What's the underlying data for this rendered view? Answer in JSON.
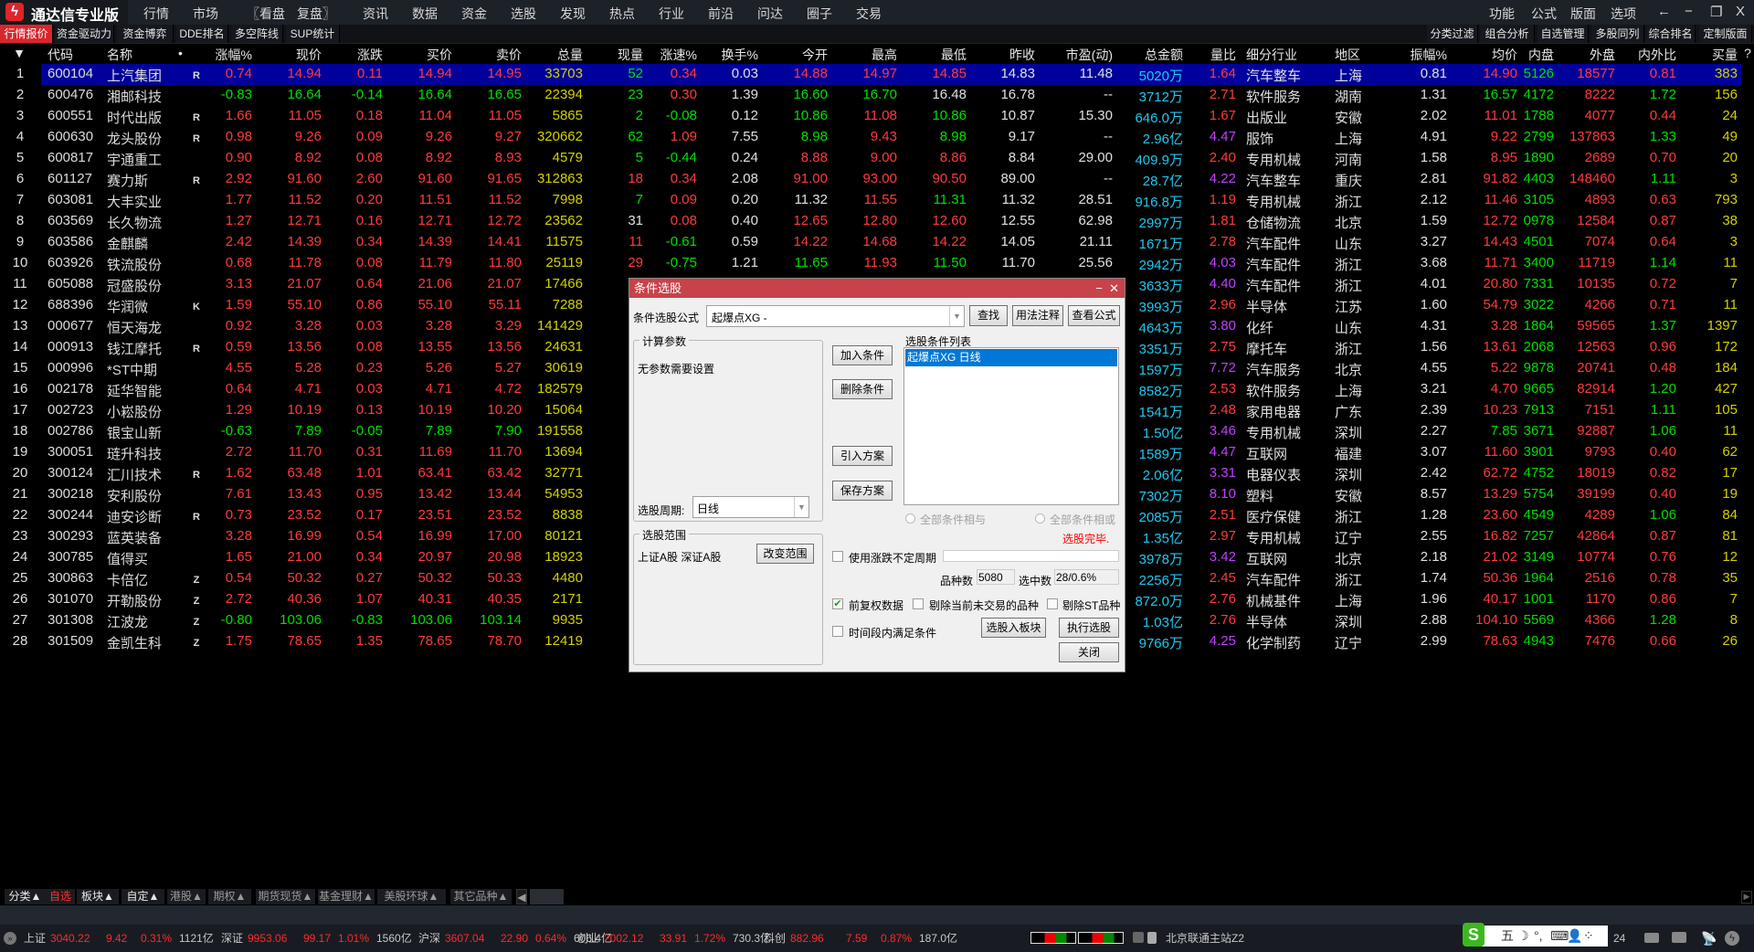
{
  "app": {
    "title": "通达信专业版",
    "logo_glyph": "ϟ"
  },
  "menu": {
    "left": [
      "行情",
      "市场",
      "〖看盘",
      "复盘〗",
      "资讯",
      "数据",
      "资金",
      "选股",
      "发现",
      "热点",
      "行业",
      "前沿",
      "问达",
      "圈子",
      "交易"
    ],
    "right": [
      "功能",
      "公式",
      "版面",
      "选项"
    ],
    "window": [
      "←",
      "−",
      "❐",
      "X"
    ]
  },
  "tabs": {
    "left": [
      "行情报价",
      "资金驱动力",
      "资金博弈",
      "DDE排名",
      "多空阵线",
      "SUP统计"
    ],
    "right": [
      "分类过滤",
      "组合分析",
      "自选管理",
      "多股同列",
      "综合排名",
      "定制版面"
    ]
  },
  "table": {
    "headers": [
      "▼",
      "代码",
      "名称",
      "•",
      "涨幅%",
      "现价",
      "涨跌",
      "买价",
      "卖价",
      "总量",
      "现量",
      "涨速%",
      "换手%",
      "今开",
      "最高",
      "最低",
      "昨收",
      "市盈(动)",
      "总金额",
      "量比",
      "细分行业",
      "地区",
      "振幅%",
      "均价",
      "内盘",
      "外盘",
      "内外比",
      "买量",
      "?"
    ],
    "colors": {
      "w": "#e0e0e0",
      "r": "#ff3b3b",
      "g": "#00e000",
      "y": "#d2d200",
      "c": "#20c8f0",
      "m": "#c040ff"
    },
    "rows": [
      {
        "cells": [
          "1",
          "600104",
          "上汽集团",
          "R",
          "0.74",
          "14.94",
          "0.11",
          "14.94",
          "14.95",
          "33703",
          "52",
          "0.34",
          "0.03",
          "14.88",
          "14.97",
          "14.85",
          "14.83",
          "11.48",
          "5020万",
          "1.64",
          "汽车整车",
          "上海",
          "0.81",
          "14.90",
          "5126",
          "18577",
          "0.81",
          "383"
        ],
        "c": "rrrrrygrwrrrwwcrwwwrgrry"
      },
      {
        "cells": [
          "2",
          "600476",
          "湘邮科技",
          "",
          "-0.83",
          "16.64",
          "-0.14",
          "16.64",
          "16.65",
          "22394",
          "23",
          "0.30",
          "1.39",
          "16.60",
          "16.70",
          "16.48",
          "16.78",
          "--",
          "3712万",
          "2.71",
          "软件服务",
          "湖南",
          "1.31",
          "16.57",
          "4172",
          "8222",
          "1.72",
          "156"
        ],
        "c": "gggggygrwggwwwcrwwwggrgy"
      },
      {
        "cells": [
          "3",
          "600551",
          "时代出版",
          "R",
          "1.66",
          "11.05",
          "0.18",
          "11.04",
          "11.05",
          "5865",
          "2",
          "-0.08",
          "0.12",
          "10.86",
          "11.08",
          "10.86",
          "10.87",
          "15.30",
          "646.0万",
          "1.67",
          "出版业",
          "安徽",
          "2.02",
          "11.01",
          "1788",
          "4077",
          "0.44",
          "24"
        ],
        "c": "rrrrryggwgrgwwcrwwwrgrry"
      },
      {
        "cells": [
          "4",
          "600630",
          "龙头股份",
          "R",
          "0.98",
          "9.26",
          "0.09",
          "9.26",
          "9.27",
          "320662",
          "62",
          "1.09",
          "7.55",
          "8.98",
          "9.43",
          "8.98",
          "9.17",
          "--",
          "2.96亿",
          "4.47",
          "服饰",
          "上海",
          "4.91",
          "9.22",
          "2799",
          "137863",
          "1.33",
          "49"
        ],
        "c": "rrrrryg rwgrgwwcmwwwrgrgy"
      },
      {
        "cells": [
          "5",
          "600817",
          "宇通重工",
          "",
          "0.90",
          "8.92",
          "0.08",
          "8.92",
          "8.93",
          "4579",
          "5",
          "-0.44",
          "0.24",
          "8.88",
          "9.00",
          "8.86",
          "8.84",
          "29.00",
          "409.9万",
          "2.40",
          "专用机械",
          "河南",
          "1.58",
          "8.95",
          "1890",
          "2689",
          "0.70",
          "20"
        ],
        "c": "rrrrrygg wrrrwwcrwwwrgrry"
      },
      {
        "cells": [
          "6",
          "601127",
          "赛力斯",
          "R",
          "2.92",
          "91.60",
          "2.60",
          "91.60",
          "91.65",
          "312863",
          "18",
          "0.34",
          "2.08",
          "91.00",
          "93.00",
          "90.50",
          "89.00",
          "--",
          "28.7亿",
          "4.22",
          "汽车整车",
          "重庆",
          "2.81",
          "91.82",
          "4403",
          "148460",
          "1.11",
          "3"
        ],
        "c": "rrrrryrrwrrrwwcmwwwrgrgy"
      },
      {
        "cells": [
          "7",
          "603081",
          "大丰实业",
          "",
          "1.77",
          "11.52",
          "0.20",
          "11.51",
          "11.52",
          "7998",
          "7",
          "0.09",
          "0.20",
          "11.32",
          "11.55",
          "11.31",
          "11.32",
          "28.51",
          "916.8万",
          "1.19",
          "专用机械",
          "浙江",
          "2.12",
          "11.46",
          "3105",
          "4893",
          "0.63",
          "793"
        ],
        "c": "rrrrrygrwwrgwwcrwwwrgrry"
      },
      {
        "cells": [
          "8",
          "603569",
          "长久物流",
          "",
          "1.27",
          "12.71",
          "0.16",
          "12.71",
          "12.72",
          "23562",
          "31",
          "0.08",
          "0.40",
          "12.65",
          "12.80",
          "12.60",
          "12.55",
          "62.98",
          "2997万",
          "1.81",
          "仓储物流",
          "北京",
          "1.59",
          "12.72",
          "0978",
          "12584",
          "0.87",
          "38"
        ],
        "c": "rrrrrywrwrrrwwcrwwwrgrry"
      },
      {
        "cells": [
          "9",
          "603586",
          "金麒麟",
          "",
          "2.42",
          "14.39",
          "0.34",
          "14.39",
          "14.41",
          "11575",
          "11",
          "-0.61",
          "0.59",
          "14.22",
          "14.68",
          "14.22",
          "14.05",
          "21.11",
          "1671万",
          "2.78",
          "汽车配件",
          "山东",
          "3.27",
          "14.43",
          "4501",
          "7074",
          "0.64",
          "3"
        ],
        "c": "rrrrryrgwrrrwwcrwwwrgrry"
      },
      {
        "cells": [
          "10",
          "603926",
          "铁流股份",
          "",
          "0.68",
          "11.78",
          "0.08",
          "11.79",
          "11.80",
          "25119",
          "29",
          "-0.75",
          "1.21",
          "11.65",
          "11.93",
          "11.50",
          "11.70",
          "25.56",
          "2942万",
          "4.03",
          "汽车配件",
          "浙江",
          "3.68",
          "11.71",
          "3400",
          "11719",
          "1.14",
          "11"
        ],
        "c": "rrrrryrgwgrgwwcmwwwrgrgy"
      },
      {
        "cells": [
          "11",
          "605088",
          "冠盛股份",
          "",
          "3.13",
          "21.07",
          "0.64",
          "21.06",
          "21.07",
          "17466",
          "",
          "",
          "",
          "",
          "",
          "",
          "",
          "",
          "3633万",
          "4.40",
          "汽车配件",
          "浙江",
          "4.01",
          "20.80",
          "7331",
          "10135",
          "0.72",
          "7"
        ],
        "c": "rrrrrywwwwwwwwcmwwwrgrry"
      },
      {
        "cells": [
          "12",
          "688396",
          "华润微",
          "K",
          "1.59",
          "55.10",
          "0.86",
          "55.10",
          "55.11",
          "7288",
          "",
          "",
          "",
          "",
          "",
          "",
          "",
          "",
          "3993万",
          "2.96",
          "半导体",
          "江苏",
          "1.60",
          "54.79",
          "3022",
          "4266",
          "0.71",
          "11"
        ],
        "c": "rrrrrywwwwwwwwcrwwwrgrry"
      },
      {
        "cells": [
          "13",
          "000677",
          "恒天海龙",
          "",
          "0.92",
          "3.28",
          "0.03",
          "3.28",
          "3.29",
          "141429",
          "",
          "",
          "",
          "",
          "",
          "",
          "",
          "",
          "4643万",
          "3.80",
          "化纤",
          "山东",
          "4.31",
          "3.28",
          "1864",
          "59565",
          "1.37",
          "1397"
        ],
        "c": "rrrrrywwwwwwwwcmwwwrgrgy"
      },
      {
        "cells": [
          "14",
          "000913",
          "钱江摩托",
          "R",
          "0.59",
          "13.56",
          "0.08",
          "13.55",
          "13.56",
          "24631",
          "",
          "",
          "",
          "",
          "",
          "",
          "",
          "",
          "3351万",
          "2.75",
          "摩托车",
          "浙江",
          "1.56",
          "13.61",
          "2068",
          "12563",
          "0.96",
          "172"
        ],
        "c": "rrrrrywwwwwwwwcrwwwrgrry"
      },
      {
        "cells": [
          "15",
          "000996",
          "*ST中期",
          "",
          "4.55",
          "5.28",
          "0.23",
          "5.26",
          "5.27",
          "30619",
          "",
          "",
          "",
          "",
          "",
          "",
          "",
          "",
          "1597万",
          "7.72",
          "汽车服务",
          "北京",
          "4.55",
          "5.22",
          "9878",
          "20741",
          "0.48",
          "184"
        ],
        "c": "rrrrrywwwwwwwwcmwwwrgrry"
      },
      {
        "cells": [
          "16",
          "002178",
          "延华智能",
          "",
          "0.64",
          "4.71",
          "0.03",
          "4.71",
          "4.72",
          "182579",
          "",
          "",
          "",
          "",
          "",
          "",
          "",
          "",
          "8582万",
          "2.53",
          "软件服务",
          "上海",
          "3.21",
          "4.70",
          "9665",
          "82914",
          "1.20",
          "427"
        ],
        "c": "rrrrrywwwwwwwwcrwwwrgrgy"
      },
      {
        "cells": [
          "17",
          "002723",
          "小崧股份",
          "",
          "1.29",
          "10.19",
          "0.13",
          "10.19",
          "10.20",
          "15064",
          "",
          "",
          "",
          "",
          "",
          "",
          "",
          "",
          "1541万",
          "2.48",
          "家用电器",
          "广东",
          "2.39",
          "10.23",
          "7913",
          "7151",
          "1.11",
          "105"
        ],
        "c": "rrrrrywwwwwwwwcrwwwrgrgy"
      },
      {
        "cells": [
          "18",
          "002786",
          "银宝山新",
          "",
          "-0.63",
          "7.89",
          "-0.05",
          "7.89",
          "7.90",
          "191558",
          "",
          "",
          "",
          "",
          "",
          "",
          "",
          "",
          "1.50亿",
          "3.46",
          "专用机械",
          "深圳",
          "2.27",
          "7.85",
          "3671",
          "92887",
          "1.06",
          "11"
        ],
        "c": "gggggywwwwwwwwcmwwwggrgy"
      },
      {
        "cells": [
          "19",
          "300051",
          "琏升科技",
          "",
          "2.72",
          "11.70",
          "0.31",
          "11.69",
          "11.70",
          "13694",
          "",
          "",
          "",
          "",
          "",
          "",
          "",
          "",
          "1589万",
          "4.47",
          "互联网",
          "福建",
          "3.07",
          "11.60",
          "3901",
          "9793",
          "0.40",
          "62"
        ],
        "c": "rrrrrywwwwwwwwcmwwwrgrry"
      },
      {
        "cells": [
          "20",
          "300124",
          "汇川技术",
          "R",
          "1.62",
          "63.48",
          "1.01",
          "63.41",
          "63.42",
          "32771",
          "",
          "",
          "",
          "",
          "",
          "",
          "",
          "",
          "2.06亿",
          "3.31",
          "电器仪表",
          "深圳",
          "2.42",
          "62.72",
          "4752",
          "18019",
          "0.82",
          "17"
        ],
        "c": "rrrrrywwwwwwwwcmwwwrgrry"
      },
      {
        "cells": [
          "21",
          "300218",
          "安利股份",
          "",
          "7.61",
          "13.43",
          "0.95",
          "13.42",
          "13.44",
          "54953",
          "",
          "",
          "",
          "",
          "",
          "",
          "",
          "",
          "7302万",
          "8.10",
          "塑料",
          "安徽",
          "8.57",
          "13.29",
          "5754",
          "39199",
          "0.40",
          "19"
        ],
        "c": "rrrrrywwwwwwwwcmwwwrgrry"
      },
      {
        "cells": [
          "22",
          "300244",
          "迪安诊断",
          "R",
          "0.73",
          "23.52",
          "0.17",
          "23.51",
          "23.52",
          "8838",
          "",
          "",
          "",
          "",
          "",
          "",
          "",
          "",
          "2085万",
          "2.51",
          "医疗保健",
          "浙江",
          "1.28",
          "23.60",
          "4549",
          "4289",
          "1.06",
          "84"
        ],
        "c": "rrrrrywwwwwwwwcrwwwrgrgy"
      },
      {
        "cells": [
          "23",
          "300293",
          "蓝英装备",
          "",
          "3.28",
          "16.99",
          "0.54",
          "16.99",
          "17.00",
          "80121",
          "",
          "",
          "",
          "",
          "",
          "",
          "",
          "",
          "1.35亿",
          "2.97",
          "专用机械",
          "辽宁",
          "2.55",
          "16.82",
          "7257",
          "42864",
          "0.87",
          "81"
        ],
        "c": "rrrrrywwwwwwwwcrwwwrgrry"
      },
      {
        "cells": [
          "24",
          "300785",
          "值得买",
          "",
          "1.65",
          "21.00",
          "0.34",
          "20.97",
          "20.98",
          "18923",
          "",
          "",
          "",
          "",
          "",
          "",
          "",
          "",
          "3978万",
          "3.42",
          "互联网",
          "北京",
          "2.18",
          "21.02",
          "3149",
          "10774",
          "0.76",
          "12"
        ],
        "c": "rrrrrywwwwwwwwcmwwwrgrry"
      },
      {
        "cells": [
          "25",
          "300863",
          "卡倍亿",
          "Z",
          "0.54",
          "50.32",
          "0.27",
          "50.32",
          "50.33",
          "4480",
          "",
          "",
          "",
          "",
          "",
          "",
          "",
          "",
          "2256万",
          "2.45",
          "汽车配件",
          "浙江",
          "1.74",
          "50.36",
          "1964",
          "2516",
          "0.78",
          "35"
        ],
        "c": "rrrrrywwwwwwwwcrwwwrgrry"
      },
      {
        "cells": [
          "26",
          "301070",
          "开勒股份",
          "Z",
          "2.72",
          "40.36",
          "1.07",
          "40.31",
          "40.35",
          "2171",
          "",
          "",
          "",
          "",
          "",
          "",
          "",
          "",
          "872.0万",
          "2.76",
          "机械基件",
          "上海",
          "1.96",
          "40.17",
          "1001",
          "1170",
          "0.86",
          "7"
        ],
        "c": "rrrrrywwwwwwwwcrwwwrgrry"
      },
      {
        "cells": [
          "27",
          "301308",
          "江波龙",
          "Z",
          "-0.80",
          "103.06",
          "-0.83",
          "103.06",
          "103.14",
          "9935",
          "",
          "",
          "",
          "",
          "",
          "",
          "",
          "",
          "1.03亿",
          "2.76",
          "半导体",
          "深圳",
          "2.88",
          "104.10",
          "5569",
          "4366",
          "1.28",
          "8"
        ],
        "c": "gggggywwwwwwwwcrwwwrgrgy"
      },
      {
        "cells": [
          "28",
          "301509",
          "金凯生科",
          "Z",
          "1.75",
          "78.65",
          "1.35",
          "78.65",
          "78.70",
          "12419",
          "",
          "",
          "",
          "",
          "",
          "",
          "",
          "",
          "9766万",
          "4.25",
          "化学制药",
          "辽宁",
          "2.99",
          "78.63",
          "4943",
          "7476",
          "0.66",
          "26"
        ],
        "c": "rrrrrywwwwwwwwcmwwwrgrry"
      }
    ]
  },
  "dialog": {
    "title": "条件选股",
    "min": "−",
    "close": "✕",
    "formula_label": "条件选股公式",
    "formula_value": "起爆点XG        -",
    "btn_find": "查找",
    "btn_usage": "用法注释",
    "btn_view": "查看公式",
    "params_group": "计算参数",
    "params_text": "无参数需要设置",
    "btn_add": "加入条件",
    "btn_delete": "删除条件",
    "btn_import": "引入方案",
    "btn_save": "保存方案",
    "list_label": "选股条件列表",
    "list_items": [
      "起爆点XG  日线"
    ],
    "period_label": "选股周期:",
    "period_value": "日线",
    "range_group": "选股范围",
    "range_text": "上证A股 深证A股",
    "btn_range": "改变范围",
    "radio_and": "全部条件相与",
    "radio_or": "全部条件相或",
    "status": "选股完毕.",
    "chk_uncertain": "使用涨跌不定周期",
    "count_label": "品种数",
    "count_value": "5080",
    "selected_label": "选中数",
    "selected_value": "28/0.6%",
    "chk_adjust": "前复权数据",
    "chk_adjust_checked": true,
    "chk_exclude_untraded": "剔除当前未交易的品种",
    "chk_exclude_st": "剔除ST品种",
    "chk_timerange": "时间段内满足条件",
    "btn_to_block": "选股入板块",
    "btn_execute": "执行选股",
    "btn_close": "关闭"
  },
  "bottom_tabs": [
    "分类▲",
    "自选",
    "板块▲",
    "自定▲",
    "港股▲",
    "期权▲",
    "期货现货▲",
    "基金理财▲",
    "美股环球▲",
    "其它品种▲"
  ],
  "status": {
    "indices": [
      {
        "name": "上证",
        "value": "3040.22",
        "change": "9.42",
        "pct": "0.31%",
        "amount": "1121亿"
      },
      {
        "name": "深证",
        "value": "9953.06",
        "change": "99.17",
        "pct": "1.01%",
        "amount": "1560亿"
      },
      {
        "name": "沪深",
        "value": "3607.04",
        "change": "22.90",
        "pct": "0.64%",
        "amount": "606.4亿"
      },
      {
        "name": "创业",
        "value": "2002.12",
        "change": "33.91",
        "pct": "1.72%",
        "amount": "730.3亿"
      },
      {
        "name": "科创",
        "value": "882.96",
        "change": "7.59",
        "pct": "0.87%",
        "amount": "187.0亿"
      }
    ],
    "server": "北京联通主站Z2",
    "ime": [
      "S",
      "五",
      "☽",
      "°,",
      "⌨",
      "👤",
      "⁘"
    ],
    "clock_fragment": "24"
  }
}
